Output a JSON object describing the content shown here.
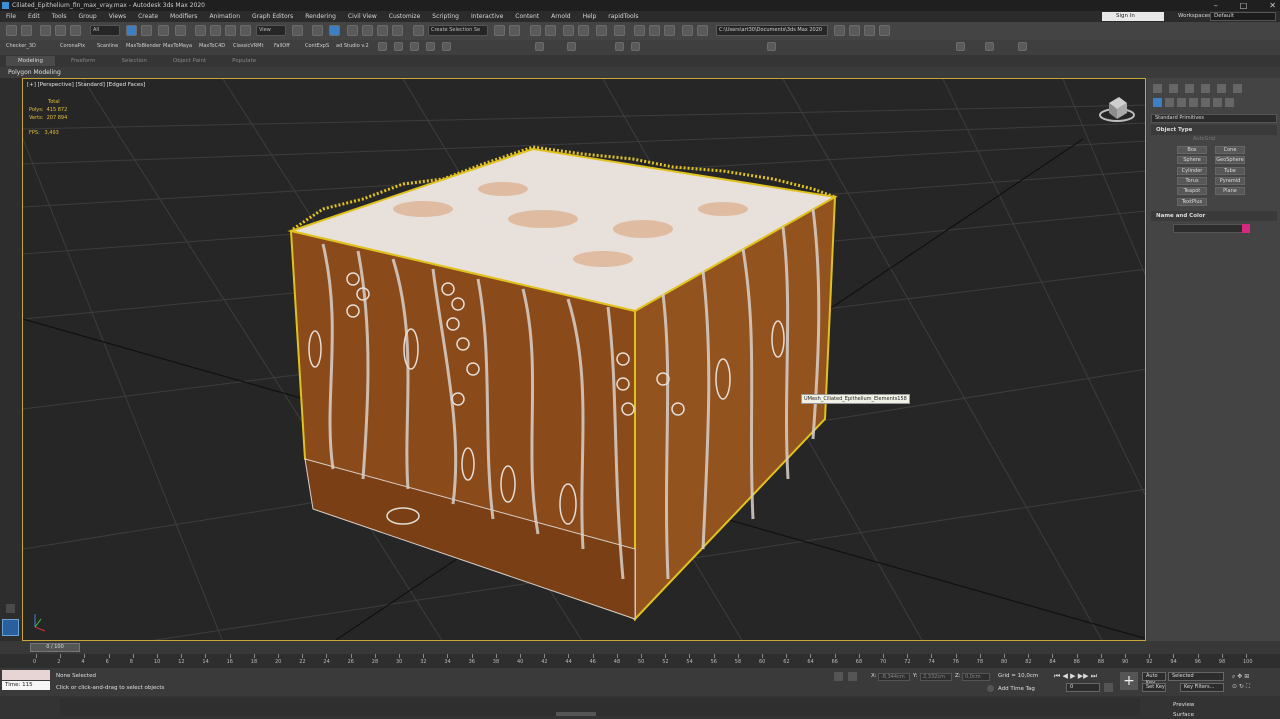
{
  "window": {
    "title": "Ciliated_Epithelium_fin_max_vray.max - Autodesk 3ds Max 2020"
  },
  "menu": [
    "File",
    "Edit",
    "Tools",
    "Group",
    "Views",
    "Create",
    "Modifiers",
    "Animation",
    "Graph Editors",
    "Rendering",
    "Civil View",
    "Customize",
    "Scripting",
    "Interactive",
    "Content",
    "Arnold",
    "Help",
    "rapidTools"
  ],
  "account": {
    "sign_in": "Sign In",
    "workspaces_label": "Workspaces:",
    "workspace": "Default"
  },
  "toolbar": {
    "filter": "All",
    "ref_coord": "View",
    "selection_set": "Create Selection Se",
    "project_path": "C:\\Users\\art30\\Documents\\3ds Max 2020"
  },
  "scripts_bar": [
    "Checker_3D",
    "CoronaPix",
    "Scanline",
    "MaxToBlender",
    "MaxToMaya",
    "MaxToC4D",
    "ClassicVRMt",
    "FallOff",
    "ContExpS",
    "ad Studio v.2"
  ],
  "ribbon": {
    "tabs": [
      "Modeling",
      "Freeform",
      "Selection",
      "Object Paint",
      "Populate"
    ],
    "active": "Modeling",
    "panel": "Polygon Modeling"
  },
  "viewport": {
    "label": "[+] [Perspective] [Standard] [Edged Faces]",
    "stats": {
      "total_label": "Total",
      "polys_label": "Polys:",
      "polys": "415 872",
      "verts_label": "Verts:",
      "verts": "207 894"
    },
    "fps_label": "FPS:",
    "fps": "3,493",
    "tooltip": "UMesh_Ciliated_Epithelium_Elements158"
  },
  "command_panel": {
    "category": "Standard Primitives",
    "object_type_title": "Object Type",
    "autogrid": "AutoGrid",
    "buttons": [
      "Box",
      "Cone",
      "Sphere",
      "GeoSphere",
      "Cylinder",
      "Tube",
      "Torus",
      "Pyramid",
      "Teapot",
      "Plane",
      "TextPlus"
    ],
    "name_color_title": "Name and Color",
    "color": "#d4297e"
  },
  "timeline": {
    "slider": "0 / 100",
    "ticks": [
      "0",
      "2",
      "4",
      "6",
      "8",
      "10",
      "12",
      "14",
      "16",
      "18",
      "20",
      "22",
      "24",
      "26",
      "28",
      "30",
      "32",
      "34",
      "36",
      "38",
      "40",
      "42",
      "44",
      "46",
      "48",
      "50",
      "52",
      "54",
      "56",
      "58",
      "60",
      "62",
      "64",
      "66",
      "68",
      "70",
      "72",
      "74",
      "76",
      "78",
      "80",
      "82",
      "84",
      "86",
      "88",
      "90",
      "92",
      "94",
      "96",
      "98",
      "100"
    ]
  },
  "status": {
    "time_label": "Time:",
    "time": "115",
    "none_selected": "None Selected",
    "prompt": "Click or click-and-drag to select objects",
    "x_label": "X:",
    "x": "-8,344cm",
    "y_label": "Y:",
    "y": "2,332cm",
    "z_label": "Z:",
    "z": "0,0cm",
    "grid": "Grid = 10,0cm",
    "add_time_tag": "Add Time Tag",
    "frame": "0",
    "auto_key": "Auto Key",
    "auto_key_mode": "Selected",
    "set_key": "Set Key",
    "key_filters": "Key Filters...",
    "preview": "Preview",
    "surface": "Surface"
  }
}
